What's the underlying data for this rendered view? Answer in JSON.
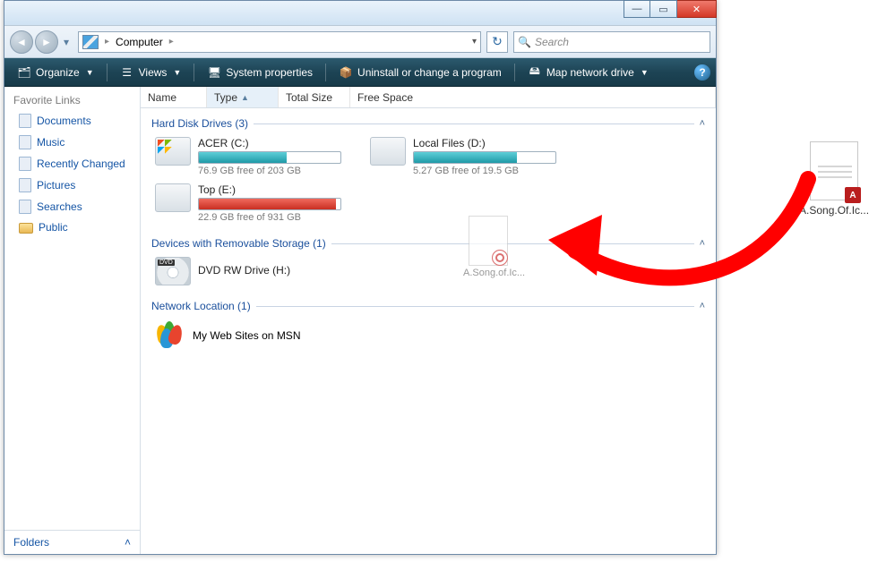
{
  "titlebar": {},
  "nav": {
    "location": "Computer",
    "refresh_glyph": "↻"
  },
  "search": {
    "placeholder": "Search",
    "glyph": "🔍"
  },
  "cmdbar": {
    "organize": "Organize",
    "views": "Views",
    "sysprops": "System properties",
    "uninstall": "Uninstall or change a program",
    "mapdrive": "Map network drive",
    "help": "?"
  },
  "sidebar": {
    "favorites_header": "Favorite Links",
    "items": [
      {
        "label": "Documents"
      },
      {
        "label": "Music"
      },
      {
        "label": "Recently Changed"
      },
      {
        "label": "Pictures"
      },
      {
        "label": "Searches"
      },
      {
        "label": "Public"
      }
    ],
    "folders_label": "Folders"
  },
  "headers": {
    "name": "Name",
    "type": "Type",
    "total_size": "Total Size",
    "free_space": "Free Space"
  },
  "groups": {
    "hdd": {
      "title": "Hard Disk Drives (3)"
    },
    "removable": {
      "title": "Devices with Removable Storage (1)"
    },
    "network": {
      "title": "Network Location (1)"
    }
  },
  "drives": {
    "c": {
      "label": "ACER (C:)",
      "sub": "76.9 GB free of 203 GB",
      "fill_pct": 62
    },
    "d": {
      "label": "Local Files (D:)",
      "sub": "5.27 GB free of 19.5 GB",
      "fill_pct": 73
    },
    "e": {
      "label": "Top (E:)",
      "sub": "22.9 GB free of 931 GB",
      "fill_pct": 97
    },
    "h": {
      "label": "DVD RW Drive (H:)"
    }
  },
  "network": {
    "msn": {
      "label": "My Web Sites on MSN"
    }
  },
  "drag_ghost": {
    "label": "A.Song.of.Ic..."
  },
  "desktop_file": {
    "label": "A.Song.Of.Ic...",
    "badge": "A"
  }
}
